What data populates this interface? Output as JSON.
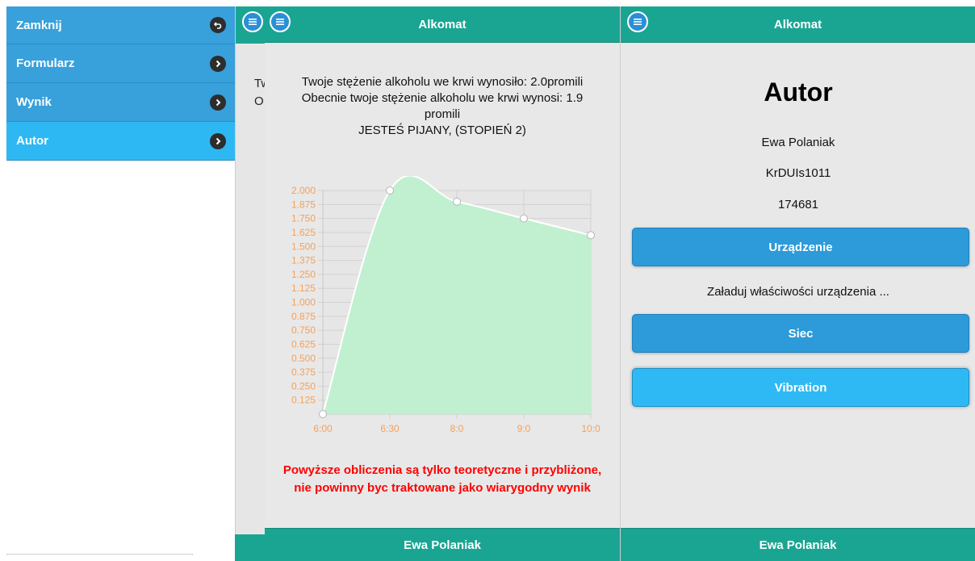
{
  "menu": {
    "items": [
      {
        "label": "Zamknij",
        "icon": "undo-icon"
      },
      {
        "label": "Formularz",
        "icon": "chevron-right-icon"
      },
      {
        "label": "Wynik",
        "icon": "chevron-right-icon"
      },
      {
        "label": "Autor",
        "icon": "chevron-right-icon",
        "active": true
      }
    ]
  },
  "behind": {
    "line1": "Tw",
    "line2": "O"
  },
  "result_page": {
    "title": "Alkomat",
    "line1": "Twoje stężenie alkoholu we krwi wynosiło: 2.0promili",
    "line2": "Obecnie twoje stężenie alkoholu we krwi wynosi: 1.9",
    "line3": "promili",
    "line4": "JESTEŚ PIJANY, (STOPIEŃ 2)",
    "warning": "Powyższe obliczenia są tylko teoretyczne i przybliżone, nie powinny byc traktowane jako wiarygodny wynik",
    "footer": "Ewa Polaniak"
  },
  "author_page": {
    "title": "Alkomat",
    "heading": "Autor",
    "name": "Ewa Polaniak",
    "login": "KrDUIs1011",
    "number": "174681",
    "device_button": "Urządzenie",
    "device_text": "Załaduj właściwości urządzenia ...",
    "network_button": "Siec",
    "vibration_button": "Vibration",
    "footer": "Ewa Polaniak"
  },
  "colors": {
    "header": "#1aa593",
    "menu": "#38a0da",
    "menu_active": "#2eb8f3",
    "button": "#2d9ad9",
    "button_highlight": "#2eb9f5",
    "chart_fill": "#bff0cf",
    "chart_axis_text": "#f5a05a",
    "warning": "#ff0000"
  },
  "chart_data": {
    "type": "area",
    "categories": [
      "6:00",
      "6:30",
      "8:0",
      "9:0",
      "10:0"
    ],
    "values": [
      0.0,
      2.0,
      1.9,
      1.75,
      1.6
    ],
    "y_ticks": [
      "0.125",
      "0.250",
      "0.375",
      "0.500",
      "0.625",
      "0.750",
      "0.875",
      "1.000",
      "1.125",
      "1.250",
      "1.375",
      "1.500",
      "1.625",
      "1.750",
      "1.875",
      "2.000"
    ],
    "ylim": [
      0,
      2.0
    ],
    "grid": true,
    "title": "",
    "xlabel": "",
    "ylabel": ""
  }
}
